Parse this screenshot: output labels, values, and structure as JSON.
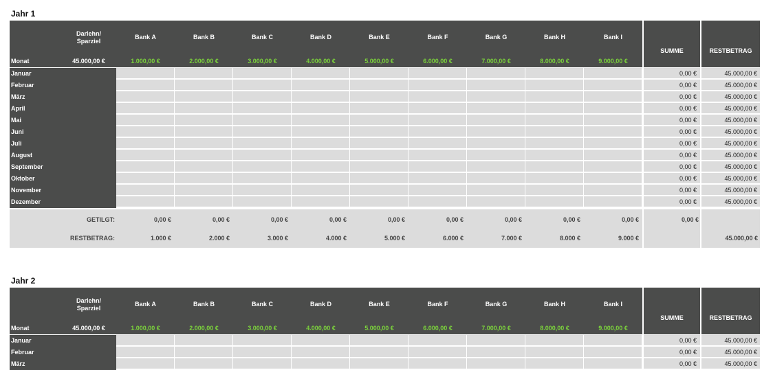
{
  "labels": {
    "darlehn": "Darlehn/\nSparziel",
    "monat": "Monat",
    "summe": "SUMME",
    "restbetrag": "RESTBETRAG",
    "getilgt": "GETILGT:",
    "restbetrag_row": "RESTBETRAG:"
  },
  "banks": [
    {
      "name": "Bank A",
      "amount": "1.000,00 €",
      "getilgt": "0,00 €",
      "rest": "1.000 €"
    },
    {
      "name": "Bank B",
      "amount": "2.000,00 €",
      "getilgt": "0,00 €",
      "rest": "2.000 €"
    },
    {
      "name": "Bank C",
      "amount": "3.000,00 €",
      "getilgt": "0,00 €",
      "rest": "3.000 €"
    },
    {
      "name": "Bank D",
      "amount": "4.000,00 €",
      "getilgt": "0,00 €",
      "rest": "4.000 €"
    },
    {
      "name": "Bank E",
      "amount": "5.000,00 €",
      "getilgt": "0,00 €",
      "rest": "5.000 €"
    },
    {
      "name": "Bank F",
      "amount": "6.000,00 €",
      "getilgt": "0,00 €",
      "rest": "6.000 €"
    },
    {
      "name": "Bank G",
      "amount": "7.000,00 €",
      "getilgt": "0,00 €",
      "rest": "7.000 €"
    },
    {
      "name": "Bank H",
      "amount": "8.000,00 €",
      "getilgt": "0,00 €",
      "rest": "8.000 €"
    },
    {
      "name": "Bank I",
      "amount": "9.000,00 €",
      "getilgt": "0,00 €",
      "rest": "9.000 €"
    }
  ],
  "months": [
    "Januar",
    "Februar",
    "März",
    "April",
    "Mai",
    "Juni",
    "Juli",
    "August",
    "September",
    "Oktober",
    "November",
    "Dezember"
  ],
  "years": [
    {
      "title": "Jahr 1",
      "total": "45.000,00 €",
      "month_sum": "0,00 €",
      "month_rest": "45.000,00 €",
      "footer_sum": "0,00 €",
      "footer_rest": "45.000,00 €",
      "visible_months": 12,
      "show_footer": true
    },
    {
      "title": "Jahr 2",
      "total": "45.000,00 €",
      "month_sum": "0,00 €",
      "month_rest": "45.000,00 €",
      "visible_months": 3,
      "show_footer": false
    }
  ],
  "colors": {
    "header_bg": "#4b4c4b",
    "cell_bg": "#dcdcdc",
    "amount_green": "#7bd23c"
  }
}
